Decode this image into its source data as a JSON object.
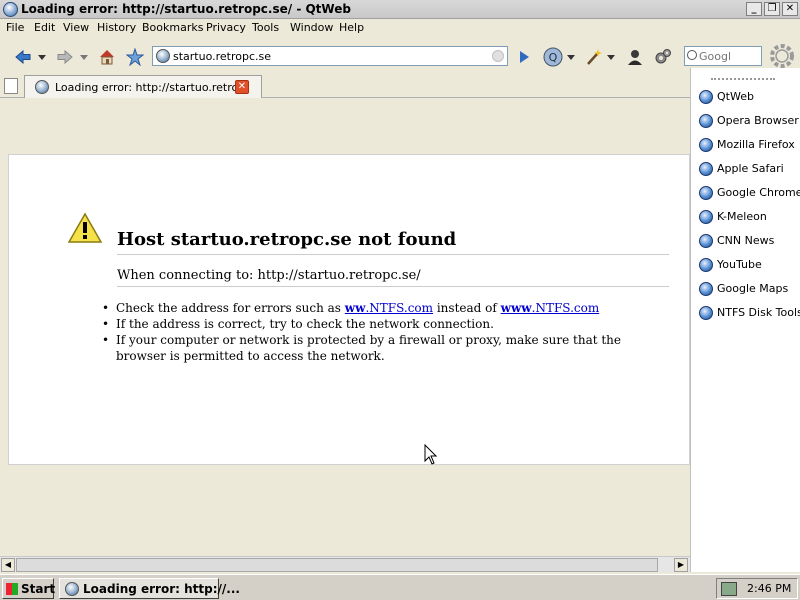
{
  "window": {
    "title": "Loading error: http://startuo.retropc.se/ - QtWeb",
    "minimize": "_",
    "maximize": "❐",
    "close": "✕"
  },
  "menu": [
    "File",
    "Edit",
    "View",
    "History",
    "Bookmarks",
    "Privacy",
    "Tools",
    "Window",
    "Help"
  ],
  "toolbar": {
    "address_value": "startuo.retropc.se",
    "search_placeholder": "Googl"
  },
  "tab": {
    "label": "Loading error: http://startuo.retro...",
    "close": "✕"
  },
  "error": {
    "title": "Host startuo.retropc.se not found",
    "subtitle": "When connecting to: http://startuo.retropc.se/",
    "bullet1_prefix": "Check the address for errors such as ",
    "bullet1_link1_bold": "ww",
    "bullet1_link1_rest": ".NTFS.com",
    "bullet1_middle": " instead of ",
    "bullet1_link2_bold": "www",
    "bullet1_link2_rest": ".NTFS.com",
    "bullet2": "If the address is correct, try to check the network connection.",
    "bullet3": "If your computer or network is protected by a firewall or proxy, make sure that the browser is permitted to access the network."
  },
  "bookmarks": [
    "QtWeb",
    "Opera Browser",
    "Mozilla Firefox",
    "Apple Safari",
    "Google Chrome",
    "K-Meleon",
    "CNN News",
    "YouTube",
    "Google Maps",
    "NTFS Disk Tools"
  ],
  "taskbar": {
    "start": "Start",
    "task_label": "Loading error: http://...",
    "clock": "2:46 PM"
  }
}
